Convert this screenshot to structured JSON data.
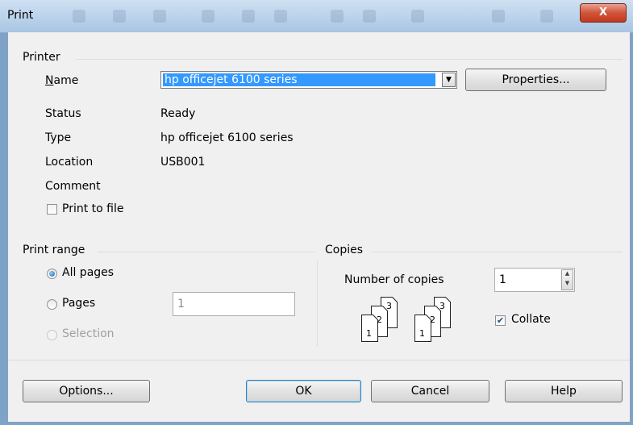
{
  "window": {
    "title": "Print",
    "close_symbol": "X"
  },
  "printer": {
    "group_label": "Printer",
    "name_label": "Name",
    "name_value": "hp officejet 6100 series",
    "properties_button": "Properties...",
    "status_label": "Status",
    "status_value": "Ready",
    "type_label": "Type",
    "type_value": "hp officejet 6100 series",
    "location_label": "Location",
    "location_value": "USB001",
    "comment_label": "Comment",
    "comment_value": "",
    "print_to_file_label": "Print to file",
    "print_to_file_checked": false
  },
  "print_range": {
    "group_label": "Print range",
    "all_pages_label": "All pages",
    "pages_label": "Pages",
    "pages_value": "1",
    "selection_label": "Selection",
    "selected": "all_pages"
  },
  "copies": {
    "group_label": "Copies",
    "number_label": "Number of copies",
    "number_value": "1",
    "collate_label": "Collate",
    "collate_checked": true,
    "icon_page_labels": [
      "1",
      "2",
      "3"
    ]
  },
  "buttons": {
    "options": "Options...",
    "ok": "OK",
    "cancel": "Cancel",
    "help": "Help"
  },
  "colors": {
    "selection": "#3399ff",
    "default_button_border": "#3c7fb1",
    "close_button": "#c8452a"
  }
}
